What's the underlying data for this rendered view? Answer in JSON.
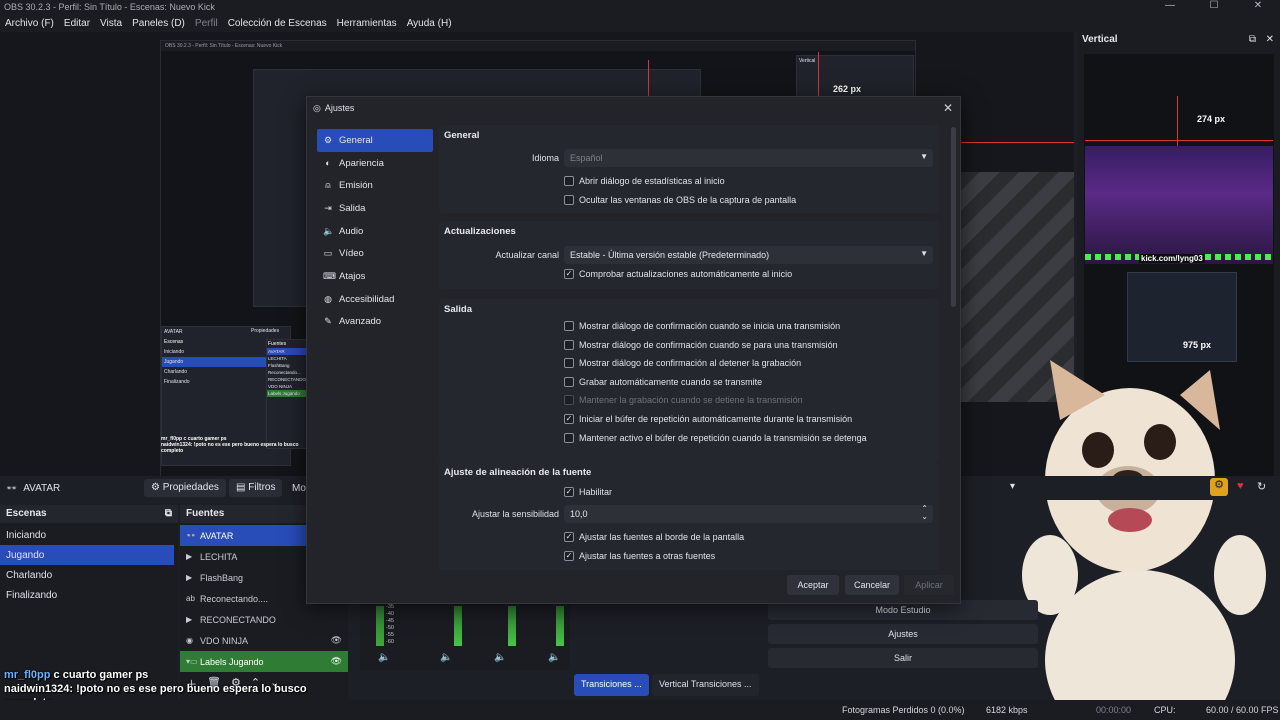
{
  "window": {
    "title": "OBS 30.2.3 - Perfil: Sin Título - Escenas: Nuevo Kick",
    "controls": [
      "—",
      "☐",
      "✕"
    ]
  },
  "menu": [
    "Archivo (F)",
    "Editar",
    "Vista",
    "Paneles (D)",
    "Perfil",
    "Colección de Escenas",
    "Herramientas",
    "Ayuda (H)"
  ],
  "preview": {
    "label_top": "262 px",
    "nested_title": "OBS 30.2.3 - Perfil: Sin Título - Escenas: Nuevo Kick",
    "nested_vertical": "Vertical",
    "nested_avatar": "AVATAR",
    "nested_props": "Propiedades",
    "nested_scenes": "Escenas",
    "nested_sources": "Fuentes",
    "nested_scene_items": [
      "Iniciando",
      "Jugando",
      "Charlando",
      "Finalizando"
    ],
    "nested_source_items": [
      "AVATAR",
      "LECHITA",
      "FlashBang",
      "Reconectando...",
      "RECONECTANDO",
      "VDO NINJA",
      "Labels Jugando"
    ],
    "nested_chat_1": "mr_fl0pp c cuarto gamer ps",
    "nested_chat_2": "naidwin1324: !poto no es ese pero bueno espera lo busco completo"
  },
  "vertical": {
    "title": "Vertical",
    "px_top": "274 px",
    "px_bottom": "975 px",
    "overlay_text": "kick.com/lyng03"
  },
  "source_toolbar": {
    "source_name": "AVATAR",
    "properties": "Propiedades",
    "filters": "Filtros",
    "more": "Mo"
  },
  "scenes": {
    "title": "Escenas",
    "items": [
      "Iniciando",
      "Jugando",
      "Charlando",
      "Finalizando"
    ],
    "selected": 1
  },
  "sources": {
    "title": "Fuentes",
    "items": [
      {
        "name": "AVATAR",
        "icon": "avatar-icon",
        "state": "selected"
      },
      {
        "name": "LECHITA",
        "icon": "play-icon",
        "state": ""
      },
      {
        "name": "FlashBang",
        "icon": "play-icon",
        "state": ""
      },
      {
        "name": "Reconectando....",
        "icon": "text-icon",
        "state": ""
      },
      {
        "name": "RECONECTANDO",
        "icon": "play-icon",
        "state": ""
      },
      {
        "name": "VDO NINJA",
        "icon": "globe-icon",
        "state": ""
      },
      {
        "name": "Labels Jugando",
        "icon": "folder-icon",
        "state": "group"
      }
    ]
  },
  "chat": {
    "user1": "mr_fl0pp",
    "msg1": "c cuarto gamer ps",
    "line2": "naidwin1324: !poto no es ese pero bueno espera lo busco",
    "line3": "completo"
  },
  "transitions": {
    "tab1": "Transiciones ...",
    "tab2": "Vertical Transiciones ..."
  },
  "controls": {
    "studio": "Modo Estudio",
    "settings": "Ajustes",
    "exit": "Salir"
  },
  "mixer": {
    "scale": [
      "-35",
      "-40",
      "-45",
      "-50",
      "-55",
      "-60"
    ]
  },
  "status": {
    "frames": "Fotogramas Perdidos 0 (0.0%)",
    "bitrate": "6182 kbps",
    "time": "00:00:00",
    "cpu": "CPU:",
    "fps": "60.00 / 60.00 FPS"
  },
  "dialog": {
    "title": "Ajustes",
    "nav": [
      {
        "label": "General",
        "icon": "gear-icon"
      },
      {
        "label": "Apariencia",
        "icon": "palette-icon"
      },
      {
        "label": "Emisión",
        "icon": "broadcast-icon"
      },
      {
        "label": "Salida",
        "icon": "output-icon"
      },
      {
        "label": "Audio",
        "icon": "audio-icon"
      },
      {
        "label": "Vídeo",
        "icon": "video-icon"
      },
      {
        "label": "Atajos",
        "icon": "keyboard-icon"
      },
      {
        "label": "Accesibilidad",
        "icon": "accessibility-icon"
      },
      {
        "label": "Avanzado",
        "icon": "wrench-icon"
      }
    ],
    "general": {
      "title": "General",
      "language_label": "Idioma",
      "language_value": "Español",
      "checks": [
        {
          "label": "Abrir diálogo de estadísticas al inicio",
          "checked": false
        },
        {
          "label": "Ocultar las ventanas de OBS de la captura de pantalla",
          "checked": false
        }
      ]
    },
    "updates": {
      "title": "Actualizaciones",
      "channel_label": "Actualizar canal",
      "channel_value": "Estable - Última versión estable (Predeterminado)",
      "checks": [
        {
          "label": "Comprobar actualizaciones automáticamente al inicio",
          "checked": true
        }
      ]
    },
    "output": {
      "title": "Salida",
      "checks": [
        {
          "label": "Mostrar diálogo de confirmación cuando se inicia una transmisión",
          "checked": false,
          "disabled": false
        },
        {
          "label": "Mostrar diálogo de confirmación cuando se para una transmisión",
          "checked": false,
          "disabled": false
        },
        {
          "label": "Mostrar diálogo de confirmación al detener la grabación",
          "checked": false,
          "disabled": false
        },
        {
          "label": "Grabar automáticamente cuando se transmite",
          "checked": false,
          "disabled": false
        },
        {
          "label": "Mantener la grabación cuando se detiene la transmisión",
          "checked": false,
          "disabled": true
        },
        {
          "label": "Iniciar el búfer de repetición automáticamente durante la transmisión",
          "checked": true,
          "disabled": false
        },
        {
          "label": "Mantener activo el búfer de repetición cuando la transmisión se detenga",
          "checked": false,
          "disabled": false
        }
      ]
    },
    "snap": {
      "title": "Ajuste de alineación de la fuente",
      "enable_label": "Habilitar",
      "enable_checked": true,
      "sensitivity_label": "Ajustar la sensibilidad",
      "sensitivity_value": "10,0",
      "checks": [
        {
          "label": "Ajustar las fuentes al borde de la pantalla",
          "checked": true
        },
        {
          "label": "Ajustar las fuentes a otras fuentes",
          "checked": true
        }
      ]
    },
    "buttons": {
      "accept": "Aceptar",
      "cancel": "Cancelar",
      "apply": "Aplicar"
    }
  },
  "colors": {
    "accent": "#284cb8",
    "group": "#2f7d34",
    "red": "#e0323a",
    "bg": "#1d1f26"
  }
}
